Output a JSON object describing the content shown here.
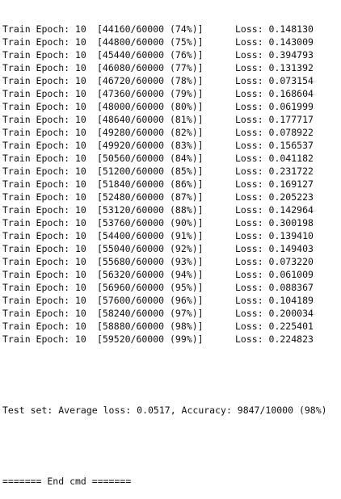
{
  "train_lines": [
    {
      "prefix": "Train Epoch: 10",
      "progress": "[44160/60000 (74%)]",
      "loss": "Loss: 0.148130"
    },
    {
      "prefix": "Train Epoch: 10",
      "progress": "[44800/60000 (75%)]",
      "loss": "Loss: 0.143009"
    },
    {
      "prefix": "Train Epoch: 10",
      "progress": "[45440/60000 (76%)]",
      "loss": "Loss: 0.394793"
    },
    {
      "prefix": "Train Epoch: 10",
      "progress": "[46080/60000 (77%)]",
      "loss": "Loss: 0.131392"
    },
    {
      "prefix": "Train Epoch: 10",
      "progress": "[46720/60000 (78%)]",
      "loss": "Loss: 0.073154"
    },
    {
      "prefix": "Train Epoch: 10",
      "progress": "[47360/60000 (79%)]",
      "loss": "Loss: 0.168604"
    },
    {
      "prefix": "Train Epoch: 10",
      "progress": "[48000/60000 (80%)]",
      "loss": "Loss: 0.061999"
    },
    {
      "prefix": "Train Epoch: 10",
      "progress": "[48640/60000 (81%)]",
      "loss": "Loss: 0.177717"
    },
    {
      "prefix": "Train Epoch: 10",
      "progress": "[49280/60000 (82%)]",
      "loss": "Loss: 0.078922"
    },
    {
      "prefix": "Train Epoch: 10",
      "progress": "[49920/60000 (83%)]",
      "loss": "Loss: 0.156537"
    },
    {
      "prefix": "Train Epoch: 10",
      "progress": "[50560/60000 (84%)]",
      "loss": "Loss: 0.041182"
    },
    {
      "prefix": "Train Epoch: 10",
      "progress": "[51200/60000 (85%)]",
      "loss": "Loss: 0.231722"
    },
    {
      "prefix": "Train Epoch: 10",
      "progress": "[51840/60000 (86%)]",
      "loss": "Loss: 0.169127"
    },
    {
      "prefix": "Train Epoch: 10",
      "progress": "[52480/60000 (87%)]",
      "loss": "Loss: 0.205223"
    },
    {
      "prefix": "Train Epoch: 10",
      "progress": "[53120/60000 (88%)]",
      "loss": "Loss: 0.142964"
    },
    {
      "prefix": "Train Epoch: 10",
      "progress": "[53760/60000 (90%)]",
      "loss": "Loss: 0.300198"
    },
    {
      "prefix": "Train Epoch: 10",
      "progress": "[54400/60000 (91%)]",
      "loss": "Loss: 0.139410"
    },
    {
      "prefix": "Train Epoch: 10",
      "progress": "[55040/60000 (92%)]",
      "loss": "Loss: 0.149403"
    },
    {
      "prefix": "Train Epoch: 10",
      "progress": "[55680/60000 (93%)]",
      "loss": "Loss: 0.073220"
    },
    {
      "prefix": "Train Epoch: 10",
      "progress": "[56320/60000 (94%)]",
      "loss": "Loss: 0.061009"
    },
    {
      "prefix": "Train Epoch: 10",
      "progress": "[56960/60000 (95%)]",
      "loss": "Loss: 0.088367"
    },
    {
      "prefix": "Train Epoch: 10",
      "progress": "[57600/60000 (96%)]",
      "loss": "Loss: 0.104189"
    },
    {
      "prefix": "Train Epoch: 10",
      "progress": "[58240/60000 (97%)]",
      "loss": "Loss: 0.200034"
    },
    {
      "prefix": "Train Epoch: 10",
      "progress": "[58880/60000 (98%)]",
      "loss": "Loss: 0.225401"
    },
    {
      "prefix": "Train Epoch: 10",
      "progress": "[59520/60000 (99%)]",
      "loss": "Loss: 0.224823"
    }
  ],
  "test_summary": "Test set: Average loss: 0.0517, Accuracy: 9847/10000 (98%)",
  "end_marker": "======= End cmd ======="
}
